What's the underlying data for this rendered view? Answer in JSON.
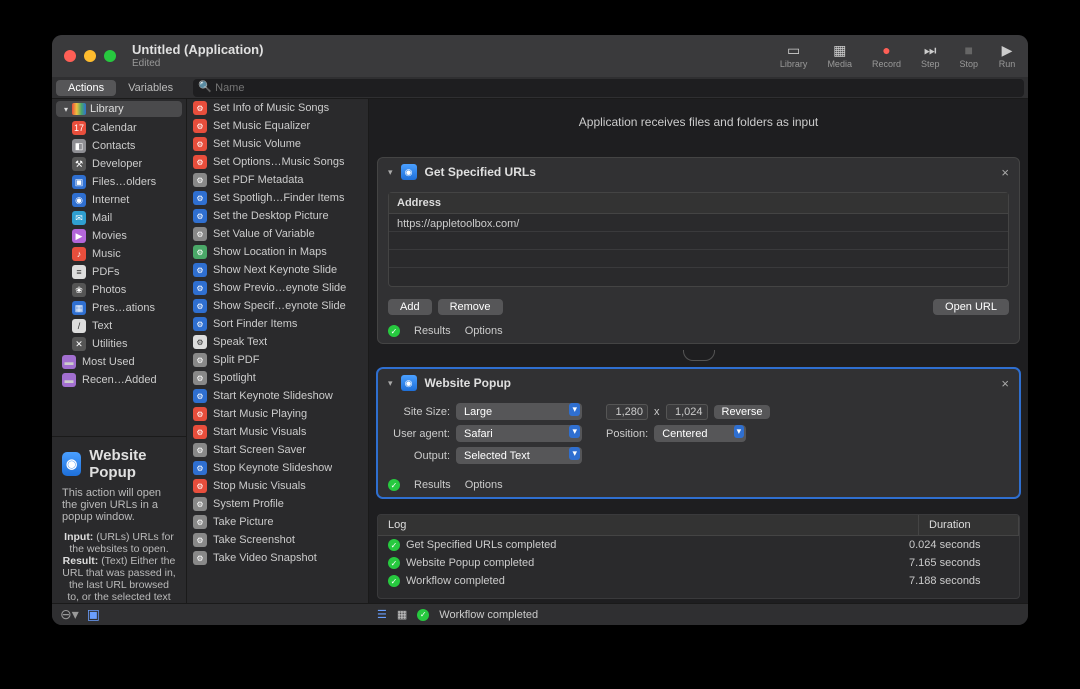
{
  "window": {
    "title": "Untitled (Application)",
    "subtitle": "Edited"
  },
  "toolbar": [
    {
      "name": "library",
      "label": "Library"
    },
    {
      "name": "media",
      "label": "Media"
    },
    {
      "name": "record",
      "label": "Record"
    },
    {
      "name": "step",
      "label": "Step"
    },
    {
      "name": "stop",
      "label": "Stop"
    },
    {
      "name": "run",
      "label": "Run"
    }
  ],
  "tabs": {
    "actions": "Actions",
    "variables": "Variables"
  },
  "search": {
    "placeholder": "Name"
  },
  "library": {
    "header": "Library",
    "items": [
      {
        "label": "Calendar",
        "color": "#e84e3c",
        "glyph": "17"
      },
      {
        "label": "Contacts",
        "color": "#8e8e93",
        "glyph": "◧"
      },
      {
        "label": "Developer",
        "color": "#555",
        "glyph": "⚒"
      },
      {
        "label": "Files…olders",
        "color": "#2f6fd0",
        "glyph": "▣"
      },
      {
        "label": "Internet",
        "color": "#2f6fd0",
        "glyph": "◉"
      },
      {
        "label": "Mail",
        "color": "#2f9fd0",
        "glyph": "✉"
      },
      {
        "label": "Movies",
        "color": "#b366d9",
        "glyph": "▶"
      },
      {
        "label": "Music",
        "color": "#e84e3c",
        "glyph": "♪"
      },
      {
        "label": "PDFs",
        "color": "#ddd",
        "glyph": "≡",
        "textcolor": "#333"
      },
      {
        "label": "Photos",
        "color": "#555",
        "glyph": "❀"
      },
      {
        "label": "Pres…ations",
        "color": "#2f6fd0",
        "glyph": "▦"
      },
      {
        "label": "Text",
        "color": "#ddd",
        "glyph": "/",
        "textcolor": "#333"
      },
      {
        "label": "Utilities",
        "color": "#555",
        "glyph": "✕"
      }
    ],
    "folders": [
      {
        "label": "Most Used",
        "color": "#a26fd0"
      },
      {
        "label": "Recen…Added",
        "color": "#a26fd0"
      }
    ]
  },
  "actions_list": [
    {
      "label": "Set Info of Music Songs",
      "color": "#e84e3c"
    },
    {
      "label": "Set Music Equalizer",
      "color": "#e84e3c"
    },
    {
      "label": "Set Music Volume",
      "color": "#e84e3c"
    },
    {
      "label": "Set Options…Music Songs",
      "color": "#e84e3c"
    },
    {
      "label": "Set PDF Metadata",
      "color": "#888"
    },
    {
      "label": "Set Spotligh…Finder Items",
      "color": "#2f6fd0"
    },
    {
      "label": "Set the Desktop Picture",
      "color": "#2f6fd0"
    },
    {
      "label": "Set Value of Variable",
      "color": "#888"
    },
    {
      "label": "Show Location in Maps",
      "color": "#4aa868"
    },
    {
      "label": "Show Next Keynote Slide",
      "color": "#2f6fd0"
    },
    {
      "label": "Show Previo…eynote Slide",
      "color": "#2f6fd0"
    },
    {
      "label": "Show Specif…eynote Slide",
      "color": "#2f6fd0"
    },
    {
      "label": "Sort Finder Items",
      "color": "#2f6fd0"
    },
    {
      "label": "Speak Text",
      "color": "#ddd",
      "textcolor": "#333"
    },
    {
      "label": "Split PDF",
      "color": "#888"
    },
    {
      "label": "Spotlight",
      "color": "#888"
    },
    {
      "label": "Start Keynote Slideshow",
      "color": "#2f6fd0"
    },
    {
      "label": "Start Music Playing",
      "color": "#e84e3c"
    },
    {
      "label": "Start Music Visuals",
      "color": "#e84e3c"
    },
    {
      "label": "Start Screen Saver",
      "color": "#888"
    },
    {
      "label": "Stop Keynote Slideshow",
      "color": "#2f6fd0"
    },
    {
      "label": "Stop Music Visuals",
      "color": "#e84e3c"
    },
    {
      "label": "System Profile",
      "color": "#888"
    },
    {
      "label": "Take Picture",
      "color": "#888"
    },
    {
      "label": "Take Screenshot",
      "color": "#888"
    },
    {
      "label": "Take Video Snapshot",
      "color": "#888"
    }
  ],
  "info": {
    "title": "Website Popup",
    "desc": "This action will open the given URLs in a popup window.",
    "input_label": "Input:",
    "input_text": "(URLs) URLs for the websites to open.",
    "result_label": "Result:",
    "result_text": "(Text) Either the URL that was passed in, the last URL browsed to, or the selected text from"
  },
  "workflow": {
    "header": "Application receives files and folders as input",
    "action1": {
      "title": "Get Specified URLs",
      "address_header": "Address",
      "url": "https://appletoolbox.com/",
      "add": "Add",
      "remove": "Remove",
      "open": "Open URL",
      "results": "Results",
      "options": "Options"
    },
    "action2": {
      "title": "Website Popup",
      "labels": {
        "site_size": "Site Size:",
        "user_agent": "User agent:",
        "output": "Output:",
        "position": "Position:",
        "x": "x"
      },
      "values": {
        "site_size": "Large",
        "user_agent": "Safari",
        "output": "Selected Text",
        "width": "1,280",
        "height": "1,024",
        "reverse": "Reverse",
        "position": "Centered"
      },
      "results": "Results",
      "options": "Options"
    }
  },
  "log": {
    "col_log": "Log",
    "col_dur": "Duration",
    "rows": [
      {
        "msg": "Get Specified URLs completed",
        "dur": "0.024 seconds"
      },
      {
        "msg": "Website Popup completed",
        "dur": "7.165 seconds"
      },
      {
        "msg": "Workflow completed",
        "dur": "7.188 seconds"
      }
    ]
  },
  "status": {
    "msg": "Workflow completed"
  }
}
